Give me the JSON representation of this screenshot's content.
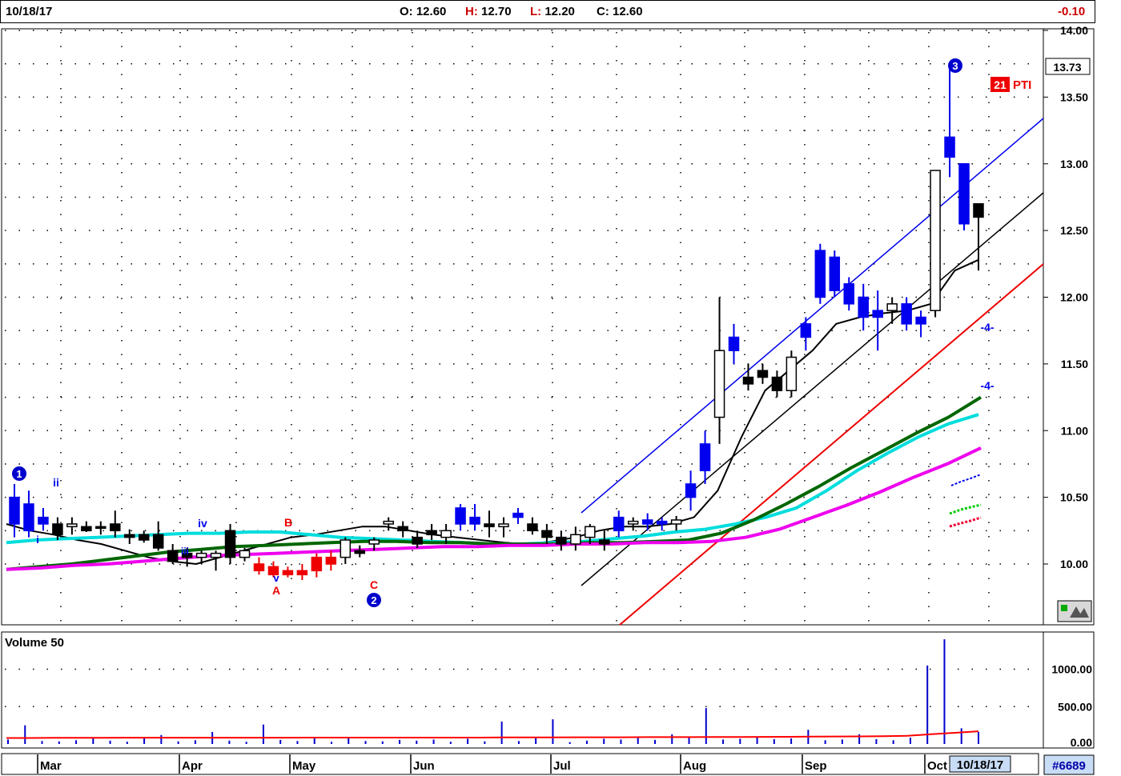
{
  "header": {
    "date": "10/18/17",
    "open_label": "O:",
    "open": "12.60",
    "high_label": "H:",
    "high": "12.70",
    "low_label": "L:",
    "low": "12.20",
    "close_label": "C:",
    "close": "12.60",
    "change": "-0.10"
  },
  "price_panel": {
    "current_price": "13.73",
    "pti_value": "21",
    "pti_label": "PTI",
    "projection_labels": [
      "-4-",
      "-4-"
    ],
    "wave_labels": [
      "1",
      "ii",
      "i",
      "iv",
      "iii",
      "v",
      "A",
      "B",
      "C",
      "2",
      "3"
    ]
  },
  "volume_panel": {
    "title": "Volume 50"
  },
  "footer": {
    "months": [
      "Mar",
      "Apr",
      "May",
      "Jun",
      "Jul",
      "Aug",
      "Sep",
      "Oct"
    ],
    "date_box": "10/18/17",
    "symbol": "#6689"
  },
  "chart_data": [
    {
      "type": "candlestick",
      "ylim": [
        9.65,
        14.0
      ],
      "y_ticks": [
        "10.00",
        "10.50",
        "11.00",
        "11.50",
        "12.00",
        "12.50",
        "13.00",
        "13.50",
        "14.00"
      ],
      "x_ticks": [
        "Mar",
        "Apr",
        "May",
        "Jun",
        "Jul",
        "Aug",
        "Sep",
        "Oct"
      ],
      "grid": true,
      "series": [
        {
          "name": "",
          "color": "#000000",
          "values": [
            10.3,
            10.25,
            10.22,
            10.18,
            10.15,
            10.1,
            10.05,
            10.02,
            10.0,
            10.05,
            10.1,
            10.15,
            10.2,
            10.22,
            10.25,
            10.28,
            10.28,
            10.25,
            10.22,
            10.2,
            10.18,
            10.16,
            10.15,
            10.17,
            10.2,
            10.25,
            10.28,
            10.28,
            10.3,
            10.35,
            10.55,
            10.95,
            11.3,
            11.45,
            11.6,
            11.8,
            11.85,
            11.88,
            11.9,
            11.95,
            12.2,
            12.28
          ]
        },
        {
          "name": "",
          "color": "#00dddd",
          "values": [
            10.16,
            10.18,
            10.19,
            10.2,
            10.21,
            10.22,
            10.23,
            10.23,
            10.24,
            10.24,
            10.22,
            10.2,
            10.19,
            10.18,
            10.17,
            10.16,
            10.15,
            10.15,
            10.16,
            10.17,
            10.19,
            10.21,
            10.24,
            10.26,
            10.3,
            10.35,
            10.42,
            10.55,
            10.7,
            10.83,
            10.95,
            11.05,
            11.12
          ]
        },
        {
          "name": "",
          "color": "#006600",
          "values": [
            9.96,
            9.98,
            10.0,
            10.03,
            10.06,
            10.09,
            10.11,
            10.13,
            10.14,
            10.15,
            10.16,
            10.17,
            10.17,
            10.16,
            10.16,
            10.15,
            10.15,
            10.15,
            10.16,
            10.16,
            10.17,
            10.18,
            10.23,
            10.33,
            10.45,
            10.58,
            10.72,
            10.85,
            10.98,
            11.1,
            11.25
          ]
        },
        {
          "name": "",
          "color": "#ee00ee",
          "values": [
            9.96,
            9.97,
            9.99,
            10.0,
            10.02,
            10.04,
            10.06,
            10.07,
            10.08,
            10.09,
            10.1,
            10.11,
            10.12,
            10.13,
            10.13,
            10.14,
            10.14,
            10.15,
            10.15,
            10.16,
            10.16,
            10.17,
            10.2,
            10.26,
            10.35,
            10.44,
            10.54,
            10.65,
            10.75,
            10.87
          ]
        }
      ],
      "candles": [
        {
          "o": 10.3,
          "h": 10.6,
          "l": 10.2,
          "c": 10.5,
          "col": "#0000ee"
        },
        {
          "o": 10.45,
          "h": 10.55,
          "l": 10.2,
          "c": 10.25,
          "col": "#0000ee"
        },
        {
          "o": 10.3,
          "h": 10.42,
          "l": 10.25,
          "c": 10.35,
          "col": "#0000ee"
        },
        {
          "o": 10.3,
          "h": 10.35,
          "l": 10.18,
          "c": 10.22,
          "col": "#000000"
        },
        {
          "o": 10.28,
          "h": 10.35,
          "l": 10.22,
          "c": 10.3,
          "col": "#000000"
        },
        {
          "o": 10.28,
          "h": 10.32,
          "l": 10.24,
          "c": 10.25,
          "col": "#000000"
        },
        {
          "o": 10.28,
          "h": 10.32,
          "l": 10.22,
          "c": 10.28,
          "col": "#000000"
        },
        {
          "o": 10.3,
          "h": 10.4,
          "l": 10.2,
          "c": 10.25,
          "col": "#000000"
        },
        {
          "o": 10.22,
          "h": 10.26,
          "l": 10.15,
          "c": 10.2,
          "col": "#000000"
        },
        {
          "o": 10.22,
          "h": 10.25,
          "l": 10.16,
          "c": 10.18,
          "col": "#000000"
        },
        {
          "o": 10.22,
          "h": 10.32,
          "l": 10.1,
          "c": 10.12,
          "col": "#000000"
        },
        {
          "o": 10.1,
          "h": 10.15,
          "l": 10.0,
          "c": 10.02,
          "col": "#000000"
        },
        {
          "o": 10.08,
          "h": 10.12,
          "l": 9.98,
          "c": 10.05,
          "col": "#000000"
        },
        {
          "o": 10.05,
          "h": 10.1,
          "l": 10.0,
          "c": 10.08,
          "col": "#000000"
        },
        {
          "o": 10.05,
          "h": 10.1,
          "l": 9.95,
          "c": 10.08,
          "col": "#000000"
        },
        {
          "o": 10.25,
          "h": 10.3,
          "l": 10.0,
          "c": 10.05,
          "col": "#000000"
        },
        {
          "o": 10.05,
          "h": 10.12,
          "l": 10.02,
          "c": 10.1,
          "col": "#000000"
        },
        {
          "o": 10.0,
          "h": 10.05,
          "l": 9.92,
          "c": 9.95,
          "col": "#ee0000"
        },
        {
          "o": 9.98,
          "h": 10.02,
          "l": 9.9,
          "c": 9.92,
          "col": "#ee0000"
        },
        {
          "o": 9.95,
          "h": 9.98,
          "l": 9.9,
          "c": 9.92,
          "col": "#ee0000"
        },
        {
          "o": 9.92,
          "h": 10.0,
          "l": 9.88,
          "c": 9.95,
          "col": "#ee0000"
        },
        {
          "o": 9.95,
          "h": 10.08,
          "l": 9.9,
          "c": 10.05,
          "col": "#ee0000"
        },
        {
          "o": 10.0,
          "h": 10.1,
          "l": 9.95,
          "c": 10.05,
          "col": "#ee0000"
        },
        {
          "o": 10.05,
          "h": 10.2,
          "l": 10.0,
          "c": 10.18,
          "col": "#000000"
        },
        {
          "o": 10.1,
          "h": 10.14,
          "l": 10.05,
          "c": 10.08,
          "col": "#000000"
        },
        {
          "o": 10.15,
          "h": 10.2,
          "l": 10.1,
          "c": 10.18,
          "col": "#000000"
        },
        {
          "o": 10.3,
          "h": 10.35,
          "l": 10.25,
          "c": 10.32,
          "col": "#000000"
        },
        {
          "o": 10.28,
          "h": 10.32,
          "l": 10.2,
          "c": 10.25,
          "col": "#000000"
        },
        {
          "o": 10.2,
          "h": 10.25,
          "l": 10.12,
          "c": 10.15,
          "col": "#000000"
        },
        {
          "o": 10.25,
          "h": 10.3,
          "l": 10.18,
          "c": 10.22,
          "col": "#000000"
        },
        {
          "o": 10.2,
          "h": 10.3,
          "l": 10.15,
          "c": 10.25,
          "col": "#000000"
        },
        {
          "o": 10.3,
          "h": 10.45,
          "l": 10.25,
          "c": 10.42,
          "col": "#0000ee"
        },
        {
          "o": 10.35,
          "h": 10.45,
          "l": 10.25,
          "c": 10.3,
          "col": "#0000ee"
        },
        {
          "o": 10.3,
          "h": 10.4,
          "l": 10.2,
          "c": 10.28,
          "col": "#000000"
        },
        {
          "o": 10.28,
          "h": 10.35,
          "l": 10.2,
          "c": 10.3,
          "col": "#000000"
        },
        {
          "o": 10.35,
          "h": 10.42,
          "l": 10.3,
          "c": 10.38,
          "col": "#0000ee"
        },
        {
          "o": 10.3,
          "h": 10.35,
          "l": 10.22,
          "c": 10.25,
          "col": "#000000"
        },
        {
          "o": 10.25,
          "h": 10.3,
          "l": 10.15,
          "c": 10.2,
          "col": "#000000"
        },
        {
          "o": 10.2,
          "h": 10.25,
          "l": 10.1,
          "c": 10.15,
          "col": "#000000"
        },
        {
          "o": 10.15,
          "h": 10.28,
          "l": 10.1,
          "c": 10.22,
          "col": "#000000"
        },
        {
          "o": 10.2,
          "h": 10.3,
          "l": 10.15,
          "c": 10.28,
          "col": "#000000"
        },
        {
          "o": 10.18,
          "h": 10.25,
          "l": 10.1,
          "c": 10.15,
          "col": "#000000"
        },
        {
          "o": 10.25,
          "h": 10.4,
          "l": 10.2,
          "c": 10.35,
          "col": "#0000ee"
        },
        {
          "o": 10.3,
          "h": 10.35,
          "l": 10.25,
          "c": 10.32,
          "col": "#000000"
        },
        {
          "o": 10.3,
          "h": 10.38,
          "l": 10.25,
          "c": 10.33,
          "col": "#0000ee"
        },
        {
          "o": 10.3,
          "h": 10.35,
          "l": 10.25,
          "c": 10.32,
          "col": "#0000ee"
        },
        {
          "o": 10.3,
          "h": 10.36,
          "l": 10.25,
          "c": 10.33,
          "col": "#000000"
        },
        {
          "o": 10.5,
          "h": 10.7,
          "l": 10.4,
          "c": 10.6,
          "col": "#0000ee"
        },
        {
          "o": 10.7,
          "h": 11.0,
          "l": 10.6,
          "c": 10.9,
          "col": "#0000ee"
        },
        {
          "o": 11.1,
          "h": 12.0,
          "l": 10.9,
          "c": 11.6,
          "col": "#000000"
        },
        {
          "o": 11.6,
          "h": 11.8,
          "l": 11.5,
          "c": 11.7,
          "col": "#0000ee"
        },
        {
          "o": 11.4,
          "h": 11.5,
          "l": 11.3,
          "c": 11.35,
          "col": "#000000"
        },
        {
          "o": 11.45,
          "h": 11.5,
          "l": 11.35,
          "c": 11.4,
          "col": "#000000"
        },
        {
          "o": 11.4,
          "h": 11.45,
          "l": 11.25,
          "c": 11.3,
          "col": "#000000"
        },
        {
          "o": 11.3,
          "h": 11.6,
          "l": 11.25,
          "c": 11.55,
          "col": "#000000"
        },
        {
          "o": 11.7,
          "h": 11.85,
          "l": 11.6,
          "c": 11.8,
          "col": "#0000ee"
        },
        {
          "o": 12.0,
          "h": 12.4,
          "l": 11.95,
          "c": 12.35,
          "col": "#0000ee"
        },
        {
          "o": 12.3,
          "h": 12.35,
          "l": 12.0,
          "c": 12.05,
          "col": "#0000ee"
        },
        {
          "o": 12.1,
          "h": 12.15,
          "l": 11.9,
          "c": 11.95,
          "col": "#0000ee"
        },
        {
          "o": 12.0,
          "h": 12.1,
          "l": 11.75,
          "c": 11.85,
          "col": "#0000ee"
        },
        {
          "o": 11.9,
          "h": 12.05,
          "l": 11.6,
          "c": 11.85,
          "col": "#0000ee"
        },
        {
          "o": 11.9,
          "h": 12.0,
          "l": 11.8,
          "c": 11.95,
          "col": "#000000"
        },
        {
          "o": 11.95,
          "h": 12.0,
          "l": 11.75,
          "c": 11.8,
          "col": "#0000ee"
        },
        {
          "o": 11.8,
          "h": 11.9,
          "l": 11.7,
          "c": 11.85,
          "col": "#0000ee"
        },
        {
          "o": 11.9,
          "h": 12.95,
          "l": 11.85,
          "c": 12.95,
          "col": "#000000"
        },
        {
          "o": 13.05,
          "h": 13.73,
          "l": 12.9,
          "c": 13.2,
          "col": "#0000ee"
        },
        {
          "o": 13.0,
          "h": 13.0,
          "l": 12.5,
          "c": 12.55,
          "col": "#0000ee"
        },
        {
          "o": 12.7,
          "h": 12.7,
          "l": 12.2,
          "c": 12.6,
          "col": "#000000"
        }
      ]
    },
    {
      "type": "bar",
      "title": "Volume 50",
      "ylim": [
        0,
        1400
      ],
      "y_ticks": [
        "0.00",
        "500.00",
        "1000.00"
      ],
      "values": [
        60,
        250,
        40,
        35,
        50,
        90,
        45,
        30,
        80,
        120,
        35,
        50,
        160,
        45,
        30,
        260,
        55,
        40,
        75,
        30,
        90,
        40,
        35,
        55,
        45,
        60,
        30,
        70,
        35,
        300,
        40,
        90,
        330,
        25,
        45,
        70,
        60,
        80,
        55,
        130,
        95,
        480,
        60,
        70,
        90,
        65,
        75,
        190,
        50,
        60,
        130,
        65,
        50,
        85,
        1050,
        1400,
        210,
        160
      ],
      "series": [
        {
          "name": "",
          "color": "#ff0000",
          "values": [
            80,
            80,
            82,
            82,
            82,
            84,
            84,
            85,
            85,
            85,
            85,
            85,
            85,
            86,
            86,
            86,
            86,
            86,
            86,
            86,
            86,
            88,
            88,
            88,
            90,
            90,
            90,
            92,
            92,
            92,
            94,
            94,
            95,
            96,
            98,
            100,
            102,
            104,
            110,
            130,
            150,
            170
          ]
        }
      ]
    }
  ]
}
